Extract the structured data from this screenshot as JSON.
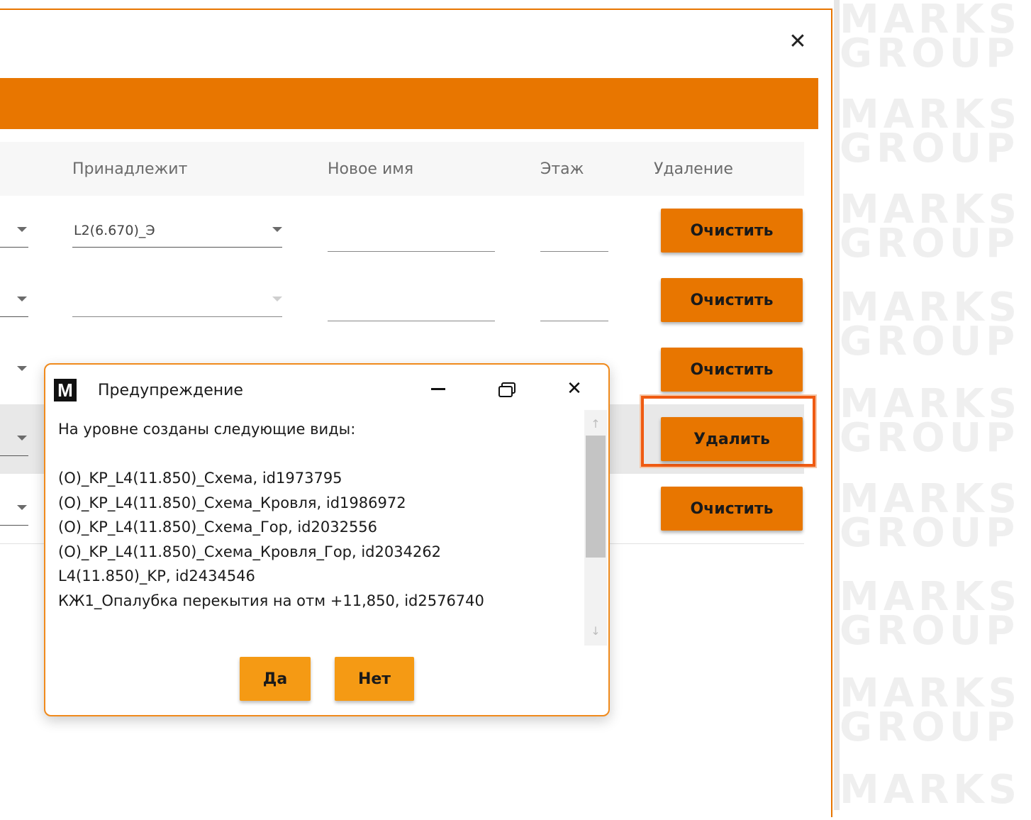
{
  "watermark": {
    "line1": "MARKS",
    "line2": "GROUP"
  },
  "main_window": {
    "close_glyph": "✕",
    "accent_color": "#e87600"
  },
  "table": {
    "headers": {
      "belongs_to": "Принадлежит",
      "new_name": "Новое имя",
      "floor": "Этаж",
      "deletion": "Удаление"
    },
    "rows": [
      {
        "belongs_to_value": "L2(6.670)_Э",
        "action_label": "Очистить",
        "selected": false
      },
      {
        "belongs_to_value": "",
        "action_label": "Очистить",
        "selected": false
      },
      {
        "belongs_to_value": "",
        "action_label": "Очистить",
        "selected": false
      },
      {
        "belongs_to_value": "",
        "action_label": "Удалить",
        "selected": true
      },
      {
        "belongs_to_value": "",
        "action_label": "Очистить",
        "selected": false
      }
    ]
  },
  "dialog": {
    "logo_letter": "M",
    "title": "Предупреждение",
    "close_glyph": "✕",
    "message_lines": [
      "На уровне созданы следующие виды:",
      "",
      "(O)_KP_L4(11.850)_Схема, id1973795",
      "(O)_KP_L4(11.850)_Схема_Кровля, id1986972",
      "(O)_KP_L4(11.850)_Схема_Гор, id2032556",
      "(O)_KP_L4(11.850)_Схема_Кровля_Гор, id2034262",
      "L4(11.850)_KP, id2434546",
      "КЖ1_Опалубка перекытия на отм +11,850, id2576740"
    ],
    "scroll_up_glyph": "↑",
    "scroll_down_glyph": "↓",
    "yes_label": "Да",
    "no_label": "Нет"
  }
}
